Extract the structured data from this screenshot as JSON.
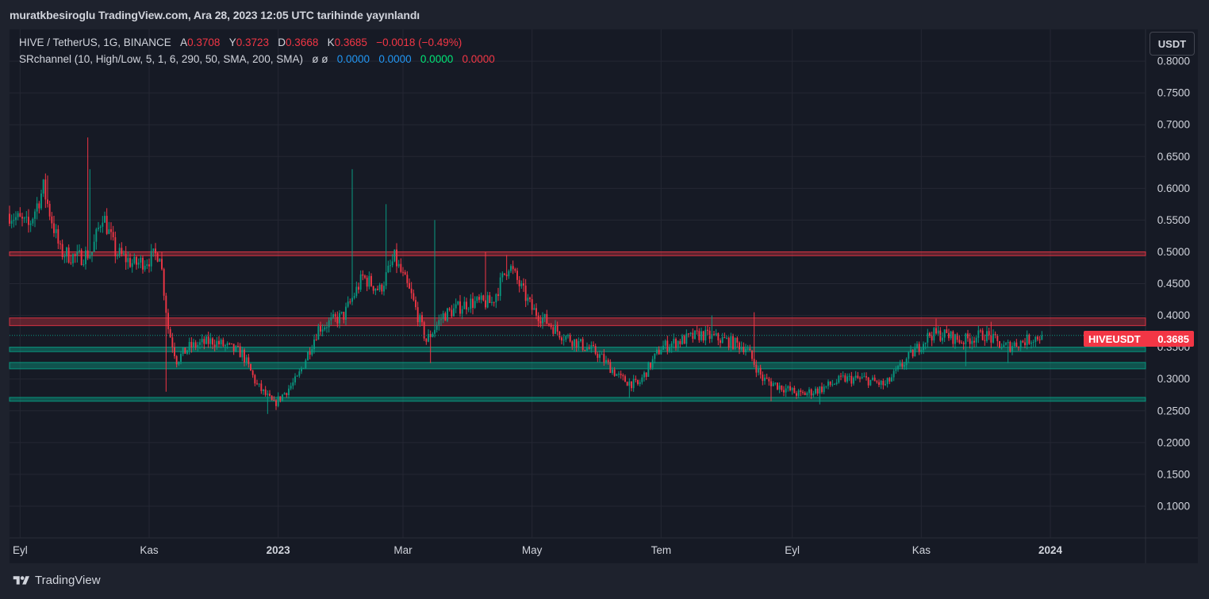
{
  "header": {
    "title": "muratkbesiroglu TradingView.com, Ara 28, 2023 12:05 UTC tarihinde yayınlandı"
  },
  "legend": {
    "symbol": "HIVE / TetherUS, 1G, BINANCE",
    "a_label": "A",
    "a_value": "0.3708",
    "y_label": "Y",
    "y_value": "0.3723",
    "d_label": "D",
    "d_value": "0.3668",
    "k_label": "K",
    "k_value": "0.3685",
    "change": "−0.0018 (−0.49%)",
    "indicator": "SRchannel (10, High/Low, 5, 1, 6, 290, 50, SMA, 200, SMA)",
    "indicator_icons": "ø  ø",
    "v1": "0.0000",
    "v2": "0.0000",
    "v3": "0.0000",
    "v4": "0.0000"
  },
  "currency_button": "USDT",
  "price_tag": {
    "symbol": "HIVEUSDT",
    "price": "0.3685"
  },
  "footer": {
    "brand": "TradingView"
  },
  "colors": {
    "up": "#089981",
    "down": "#f23645",
    "resistance": "#f23645",
    "support": "#089981",
    "text": "#d1d4dc",
    "grid": "#242733"
  },
  "chart_data": {
    "type": "candlestick",
    "ylim": [
      0.05,
      0.85
    ],
    "y_ticks": [
      0.8,
      0.75,
      0.7,
      0.65,
      0.6,
      0.55,
      0.5,
      0.45,
      0.4,
      0.35,
      0.3,
      0.25,
      0.2,
      0.15,
      0.1
    ],
    "y_tick_labels": [
      "0.8000",
      "0.7500",
      "0.7000",
      "0.6500",
      "0.6000",
      "0.5500",
      "0.5000",
      "0.4500",
      "0.4000",
      "0.3500",
      "0.3000",
      "0.2500",
      "0.2000",
      "0.1500",
      "0.1000"
    ],
    "x_labels": [
      {
        "label": "Eyl",
        "date": "2022-09-01",
        "bold": false
      },
      {
        "label": "Kas",
        "date": "2022-11-01",
        "bold": false
      },
      {
        "label": "2023",
        "date": "2023-01-01",
        "bold": true
      },
      {
        "label": "Mar",
        "date": "2023-03-01",
        "bold": false
      },
      {
        "label": "May",
        "date": "2023-05-01",
        "bold": false
      },
      {
        "label": "Tem",
        "date": "2023-07-01",
        "bold": false
      },
      {
        "label": "Eyl",
        "date": "2023-09-01",
        "bold": false
      },
      {
        "label": "Kas",
        "date": "2023-11-01",
        "bold": false
      },
      {
        "label": "2024",
        "date": "2024-01-01",
        "bold": true
      }
    ],
    "x_range": [
      "2022-08-27",
      "2024-02-15"
    ],
    "data_range": [
      "2022-08-27",
      "2023-12-28"
    ],
    "last_price": 0.3685,
    "resistance_zones": [
      [
        0.494,
        0.5
      ],
      [
        0.384,
        0.396
      ]
    ],
    "support_zones": [
      [
        0.343,
        0.35
      ],
      [
        0.316,
        0.326
      ],
      [
        0.265,
        0.271
      ]
    ],
    "price_path": [
      [
        "2022-08-27",
        0.56
      ],
      [
        "2022-09-05",
        0.54
      ],
      [
        "2022-09-12",
        0.6
      ],
      [
        "2022-09-20",
        0.5
      ],
      [
        "2022-09-28",
        0.49
      ],
      [
        "2022-10-05",
        0.5
      ],
      [
        "2022-10-10",
        0.56
      ],
      [
        "2022-10-16",
        0.5
      ],
      [
        "2022-10-25",
        0.48
      ],
      [
        "2022-11-02",
        0.49
      ],
      [
        "2022-11-06",
        0.5
      ],
      [
        "2022-11-10",
        0.38
      ],
      [
        "2022-11-14",
        0.33
      ],
      [
        "2022-11-20",
        0.35
      ],
      [
        "2022-12-01",
        0.36
      ],
      [
        "2022-12-15",
        0.34
      ],
      [
        "2022-12-22",
        0.29
      ],
      [
        "2022-12-30",
        0.26
      ],
      [
        "2023-01-10",
        0.3
      ],
      [
        "2023-01-20",
        0.38
      ],
      [
        "2023-02-01",
        0.4
      ],
      [
        "2023-02-10",
        0.46
      ],
      [
        "2023-02-18",
        0.44
      ],
      [
        "2023-02-25",
        0.49
      ],
      [
        "2023-03-05",
        0.43
      ],
      [
        "2023-03-12",
        0.36
      ],
      [
        "2023-03-20",
        0.4
      ],
      [
        "2023-04-01",
        0.42
      ],
      [
        "2023-04-12",
        0.42
      ],
      [
        "2023-04-20",
        0.48
      ],
      [
        "2023-05-01",
        0.41
      ],
      [
        "2023-05-15",
        0.37
      ],
      [
        "2023-06-01",
        0.34
      ],
      [
        "2023-06-12",
        0.3
      ],
      [
        "2023-06-20",
        0.29
      ],
      [
        "2023-07-01",
        0.35
      ],
      [
        "2023-07-10",
        0.36
      ],
      [
        "2023-07-20",
        0.37
      ],
      [
        "2023-08-01",
        0.36
      ],
      [
        "2023-08-10",
        0.35
      ],
      [
        "2023-08-18",
        0.3
      ],
      [
        "2023-08-25",
        0.29
      ],
      [
        "2023-09-05",
        0.275
      ],
      [
        "2023-09-15",
        0.285
      ],
      [
        "2023-09-25",
        0.3
      ],
      [
        "2023-10-05",
        0.3
      ],
      [
        "2023-10-15",
        0.29
      ],
      [
        "2023-10-25",
        0.33
      ],
      [
        "2023-11-05",
        0.37
      ],
      [
        "2023-11-12",
        0.37
      ],
      [
        "2023-11-20",
        0.36
      ],
      [
        "2023-12-01",
        0.37
      ],
      [
        "2023-12-10",
        0.35
      ],
      [
        "2023-12-20",
        0.36
      ],
      [
        "2023-12-28",
        0.3685
      ]
    ],
    "spikes": [
      [
        "2022-10-03",
        0.68
      ],
      [
        "2022-10-04",
        0.63
      ],
      [
        "2022-09-14",
        0.62
      ],
      [
        "2023-02-05",
        0.63
      ],
      [
        "2023-02-21",
        0.575
      ],
      [
        "2023-03-16",
        0.55
      ],
      [
        "2023-04-09",
        0.5
      ],
      [
        "2023-04-19",
        0.495
      ],
      [
        "2023-08-14",
        0.405
      ],
      [
        "2023-07-25",
        0.4
      ],
      [
        "2023-11-08",
        0.395
      ],
      [
        "2023-12-04",
        0.39
      ]
    ],
    "dips": [
      [
        "2022-11-09",
        0.28
      ],
      [
        "2022-12-27",
        0.245
      ],
      [
        "2023-03-14",
        0.325
      ],
      [
        "2023-06-16",
        0.27
      ],
      [
        "2023-08-22",
        0.265
      ],
      [
        "2023-09-14",
        0.26
      ],
      [
        "2023-11-22",
        0.32
      ],
      [
        "2023-12-12",
        0.325
      ]
    ]
  }
}
